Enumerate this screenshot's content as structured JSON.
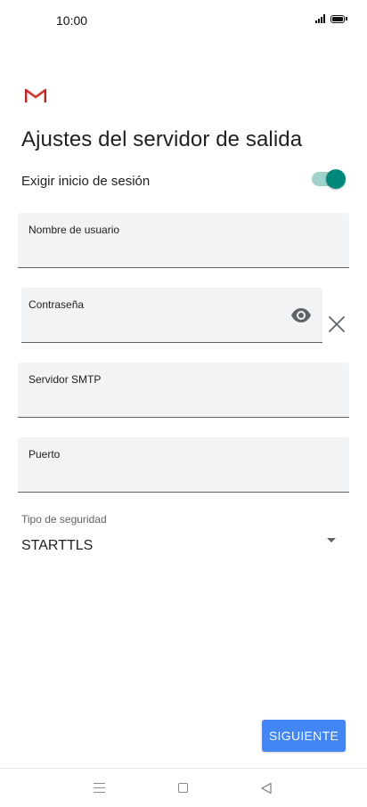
{
  "status_bar": {
    "time": "10:00"
  },
  "colors": {
    "accent": "#00897b",
    "button": "#4285f4",
    "field_bg": "#f1f3f4"
  },
  "header": {
    "logo_icon": "gmail-logo-icon",
    "title": "Ajustes del servidor de salida"
  },
  "login_toggle": {
    "label": "Exigir inicio de sesión",
    "on": true
  },
  "fields": {
    "username": {
      "label": "Nombre de usuario",
      "value": ""
    },
    "password": {
      "label": "Contraseña",
      "value": "",
      "show_icon": "eye-icon",
      "clear_icon": "close-icon"
    },
    "smtp_server": {
      "label": "Servidor SMTP",
      "value": ""
    },
    "port": {
      "label": "Puerto",
      "value": ""
    }
  },
  "security": {
    "label": "Tipo de seguridad",
    "value": "STARTTLS"
  },
  "next_button": {
    "label": "SIGUIENTE"
  },
  "nav_bar": {
    "icons": [
      "menu-icon",
      "home-icon",
      "back-icon"
    ]
  }
}
